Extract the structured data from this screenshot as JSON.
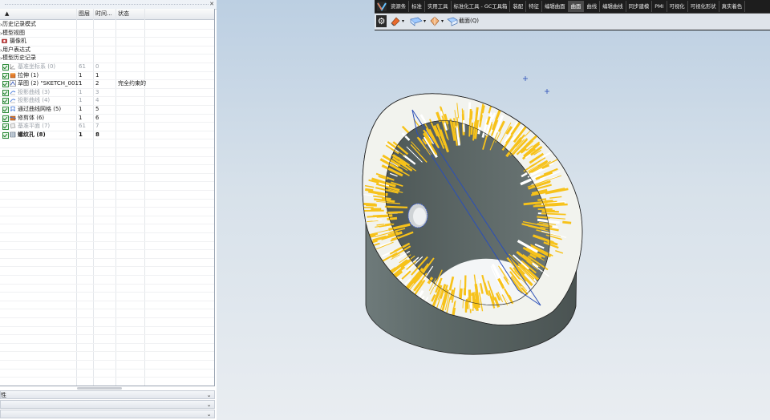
{
  "navigator": {
    "columns": [
      "",
      "图层",
      "时间...",
      "状态"
    ],
    "rows": [
      {
        "name": "历史记录模式",
        "icon": "history-mode-icon"
      },
      {
        "name": "模型视图",
        "icon": "model-views-icon"
      },
      {
        "name": "摄像机",
        "icon": "camera-icon"
      },
      {
        "name": "用户表达式",
        "icon": "user-expressions-icon"
      },
      {
        "name": "模型历史记录",
        "icon": "model-history-icon"
      },
      {
        "name": "基准坐标系 (0)",
        "layer": "61",
        "time": "0",
        "status": "",
        "icon": "datum-csys-icon",
        "dim": true
      },
      {
        "name": "拉伸 (1)",
        "layer": "1",
        "time": "1",
        "status": "",
        "icon": "extrude-icon"
      },
      {
        "name": "草图 (2) \"SKETCH_001\"",
        "layer": "1",
        "time": "2",
        "status": "完全约束的",
        "icon": "sketch-icon"
      },
      {
        "name": "投影曲线 (3)",
        "layer": "1",
        "time": "3",
        "status": "",
        "icon": "projected-curve-icon",
        "dim": true
      },
      {
        "name": "投影曲线 (4)",
        "layer": "1",
        "time": "4",
        "status": "",
        "icon": "projected-curve-icon",
        "dim": true
      },
      {
        "name": "通过曲线网格 (5)",
        "layer": "1",
        "time": "5",
        "status": "",
        "icon": "curve-mesh-icon"
      },
      {
        "name": "修剪体 (6)",
        "layer": "1",
        "time": "6",
        "status": "",
        "icon": "trim-body-icon"
      },
      {
        "name": "基准平面 (7)",
        "layer": "61",
        "time": "7",
        "status": "",
        "icon": "datum-plane-icon",
        "dim": true
      },
      {
        "name": "螺纹孔 (8)",
        "layer": "1",
        "time": "8",
        "status": "",
        "icon": "threaded-hole-icon",
        "bold": true
      }
    ],
    "panels": [
      "性",
      "",
      ""
    ]
  },
  "ribbon": {
    "tabs": [
      "资源条",
      "标准",
      "实用工具",
      "标准化工具 - GC工具箱",
      "装配",
      "特征",
      "编辑曲面",
      "曲面",
      "曲线",
      "编辑曲线",
      "同步建模",
      "PMI",
      "可视化",
      "可视化形状",
      "真实着色"
    ],
    "active_tab": "曲面",
    "view_label": "截面(Q)"
  },
  "colors": {
    "accent": "#2b4fb8",
    "background_top": "#bccfe2",
    "body": "#5d6b6a",
    "draft_face": "#f7c21a",
    "ribbon_bg": "#1d1d1d"
  }
}
